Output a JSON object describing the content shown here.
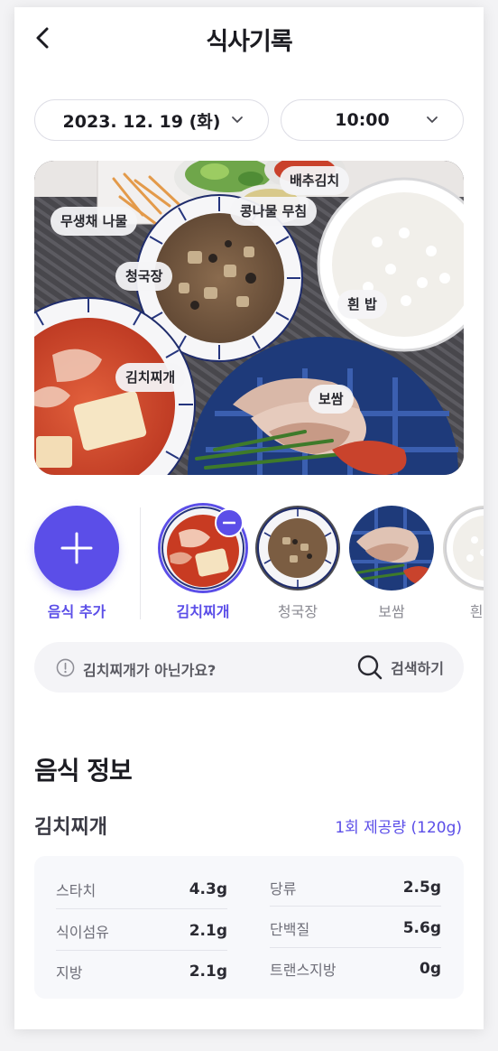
{
  "header": {
    "title": "식사기록",
    "back_icon": "chevron-left-icon"
  },
  "date_selector": {
    "value": "2023. 12. 19 (화)",
    "icon": "chevron-down-icon"
  },
  "time_selector": {
    "value": "10:00",
    "icon": "chevron-down-icon"
  },
  "photo_tags": [
    "배추김치",
    "콩나물 무침",
    "무생채 나물",
    "청국장",
    "흰 밥",
    "김치찌개",
    "보쌈"
  ],
  "carousel": {
    "add_label": "음식 추가",
    "items": [
      {
        "label": "김치찌개",
        "selected": true
      },
      {
        "label": "청국장",
        "selected": false
      },
      {
        "label": "보쌈",
        "selected": false
      },
      {
        "label": "흰 밥",
        "selected": false
      }
    ]
  },
  "suggestion": {
    "text": "김치찌개가 아닌가요?",
    "search_label": "검색하기"
  },
  "nutrition": {
    "section_title": "음식 정보",
    "food_name": "김치찌개",
    "serving": "1회 제공량 (120g)",
    "left": [
      {
        "name": "스타치",
        "value": "4.3g"
      },
      {
        "name": "식이섬유",
        "value": "2.1g"
      },
      {
        "name": "지방",
        "value": "2.1g"
      }
    ],
    "right": [
      {
        "name": "당류",
        "value": "2.5g"
      },
      {
        "name": "단백질",
        "value": "5.6g"
      },
      {
        "name": "트랜스지방",
        "value": "0g"
      }
    ]
  },
  "colors": {
    "accent": "#5b4ee8",
    "text": "#1c1c22",
    "muted": "#8a8a92"
  }
}
